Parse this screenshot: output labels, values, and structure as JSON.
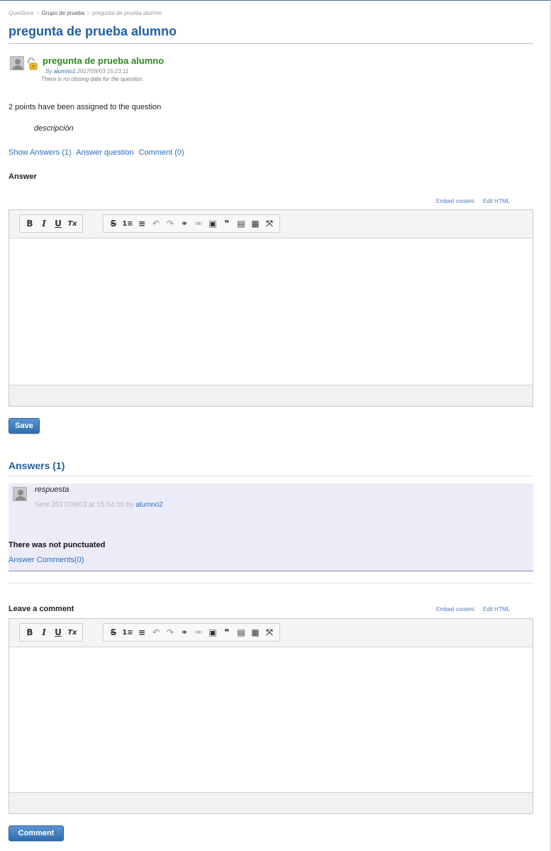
{
  "breadcrumb": {
    "root": "Questions",
    "group": "Grupo de prueba",
    "current": "pregunta de prueba alumno",
    "separator": ">"
  },
  "page_title": "pregunta de prueba alumno",
  "question": {
    "title": "pregunta de prueba alumno",
    "by_prefix": "By",
    "author": "alumno1",
    "date": "2017/09/03 15:23:11",
    "closing": "There is no closing date for the question.",
    "points": "2 points have been assigned to the question",
    "description": "descripción"
  },
  "actions": {
    "show_answers": "Show Answers (1)",
    "answer_question": "Answer question",
    "comment": "Comment (0)"
  },
  "answer_form": {
    "label": "Answer",
    "embed_content": "Embed content",
    "edit_html": "Edit HTML",
    "save_label": "Save"
  },
  "answers_section": {
    "title": "Answers (1)",
    "items": [
      {
        "text": "respuesta",
        "sent_prefix": "Sent 2017/09/03 at 15:54:00 by",
        "user": "alumno2",
        "status": "There was not punctuated",
        "comments_link": "Answer Comments(0)"
      }
    ]
  },
  "comment_form": {
    "label": "Leave a comment",
    "embed_content": "Embed content",
    "edit_html": "Edit HTML",
    "submit_label": "Comment"
  },
  "toolbar": {
    "bold": "B",
    "italic": "I",
    "underline": "U",
    "clear_format": "Tx",
    "strike": "S",
    "numbered_list": "1≡",
    "bullet_list": "≡",
    "undo": "↶",
    "redo": "↷",
    "link": "⚭",
    "unlink": "⚮",
    "image": "▣",
    "quote": "❞",
    "paste_text": "▤",
    "paste_word": "▦",
    "fullscreen": "⤧"
  },
  "colors": {
    "title_blue": "#1f5fa3",
    "link_blue": "#2a6fb8",
    "question_green": "#2e8b22",
    "answer_bg": "#ececf9",
    "button_blue": "#3a7bc0"
  }
}
